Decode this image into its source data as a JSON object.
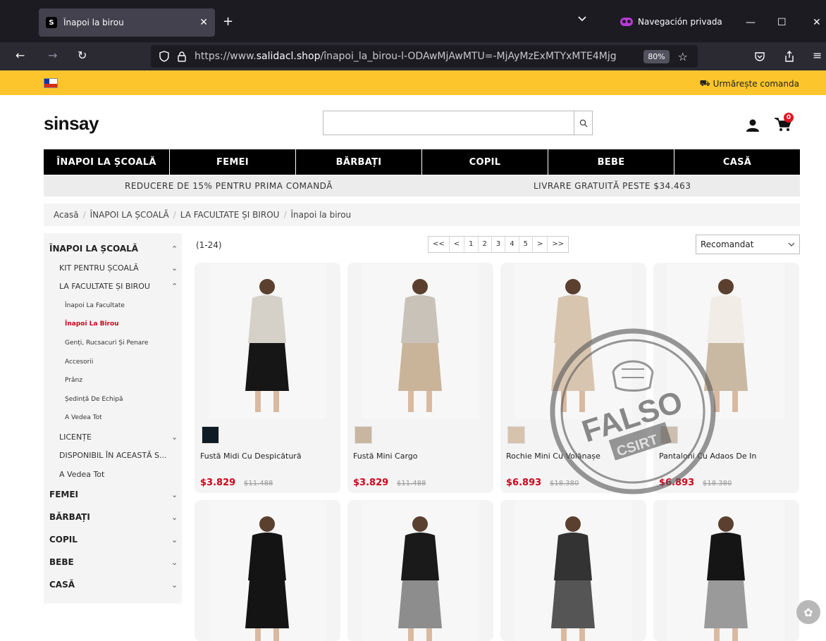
{
  "browser": {
    "tab_title": "Înapoi la birou",
    "favicon_letter": "S",
    "private_label": "Navegación privada",
    "url_prefix": "https://www.",
    "url_domain": "salidacl.shop",
    "url_path": "/înapoi_la_birou-l-ODAwMjAwMTU=-MjAyMzExMTYxMTE4Mjg",
    "zoom": "80%"
  },
  "topbar": {
    "track_order": "Urmărește comanda"
  },
  "header": {
    "logo": "sinsay",
    "search_placeholder": "",
    "cart_count": "0"
  },
  "categories": [
    "ÎNAPOI LA ȘCOALĂ",
    "FEMEI",
    "BĂRBAȚI",
    "COPIL",
    "BEBE",
    "CASĂ"
  ],
  "promo": {
    "left": "REDUCERE DE 15% PENTRU PRIMA COMANDĂ",
    "right": "LIVRARE GRATUITĂ PESTE $34.463"
  },
  "breadcrumb": [
    "Acasă",
    "ÎNAPOI LA ȘCOALĂ",
    "LA FACULTATE ȘI BIROU",
    "Înapoi la birou"
  ],
  "sidebar": [
    {
      "label": "ÎNAPOI LA ȘCOALĂ",
      "level": 1,
      "chevron": "up"
    },
    {
      "label": "KIT PENTRU ȘCOALĂ",
      "level": 2,
      "chevron": "down"
    },
    {
      "label": "LA FACULTATE ȘI BIROU",
      "level": 2,
      "chevron": "up"
    },
    {
      "label": "Înapoi La Facultate",
      "level": 3
    },
    {
      "label": "Înapoi La Birou",
      "level": 3,
      "active": true
    },
    {
      "label": "Genți, Rucsacuri Și Penare",
      "level": 3
    },
    {
      "label": "Accesorii",
      "level": 3
    },
    {
      "label": "Prânz",
      "level": 3
    },
    {
      "label": "Ședință De Echipă",
      "level": 3
    },
    {
      "label": "A Vedea Tot",
      "level": 3
    },
    {
      "label": "LICENȚE",
      "level": 2,
      "chevron": "down"
    },
    {
      "label": "DISPONIBIL ÎN ACEASTĂ S...",
      "level": 2
    },
    {
      "label": "A Vedea Tot",
      "level": 2
    },
    {
      "label": "FEMEI",
      "level": 1,
      "chevron": "down"
    },
    {
      "label": "BĂRBAȚI",
      "level": 1,
      "chevron": "down"
    },
    {
      "label": "COPIL",
      "level": 1,
      "chevron": "down"
    },
    {
      "label": "BEBE",
      "level": 1,
      "chevron": "down"
    },
    {
      "label": "CASĂ",
      "level": 1,
      "chevron": "down"
    }
  ],
  "listing": {
    "count": "(1-24)",
    "pager": [
      "<<",
      "<",
      "1",
      "2",
      "3",
      "4",
      "5",
      ">",
      ">>"
    ],
    "sort": "Recomandat"
  },
  "products": [
    {
      "name": "Fustă Midi Cu Despicătură",
      "price": "$3.829",
      "old": "$11.488",
      "swatch": "#0e1a24",
      "top": "#d6d1c8",
      "bottom": "#161616"
    },
    {
      "name": "Fustă Mini Cargo",
      "price": "$3.829",
      "old": "$11.488",
      "swatch": "#c9b6a1",
      "top": "#c8c2b8",
      "bottom": "#c9b49a"
    },
    {
      "name": "Rochie Mini Cu Volănașe",
      "price": "$6.893",
      "old": "$18.380",
      "swatch": "#d6c2ad",
      "top": "#d8c5b0",
      "bottom": "#d8c5b0"
    },
    {
      "name": "Pantaloni Cu Adaos De In",
      "price": "$6.893",
      "old": "$18.380",
      "swatch": "#cdbfae",
      "top": "#f1ede6",
      "bottom": "#c9b9a2"
    },
    {
      "name": "",
      "price": "",
      "old": "",
      "swatch": "",
      "top": "#141414",
      "bottom": "#141414"
    },
    {
      "name": "",
      "price": "",
      "old": "",
      "swatch": "",
      "top": "#1a1a1a",
      "bottom": "#8d8d8d"
    },
    {
      "name": "",
      "price": "",
      "old": "",
      "swatch": "",
      "top": "#333333",
      "bottom": "#555555"
    },
    {
      "name": "",
      "price": "",
      "old": "",
      "swatch": "",
      "top": "#151515",
      "bottom": "#9a9a9a"
    }
  ],
  "stamp": {
    "main": "FALSO",
    "sub": "CSIRT"
  }
}
